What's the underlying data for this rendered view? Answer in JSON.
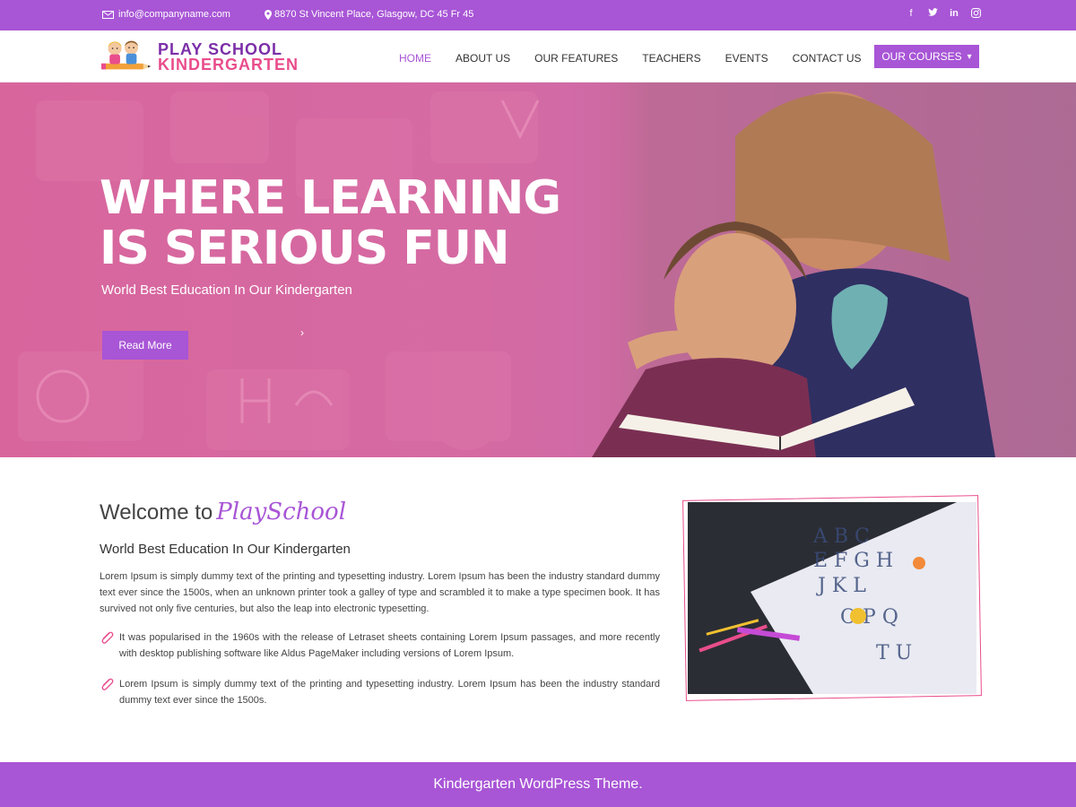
{
  "topbar": {
    "email": "info@companyname.com",
    "address": "8870 St Vincent Place, Glasgow, DC 45 Fr 45",
    "social": [
      {
        "icon": "facebook-icon",
        "glyph": "f"
      },
      {
        "icon": "twitter-icon",
        "glyph": "t"
      },
      {
        "icon": "linkedin-icon",
        "glyph": "in"
      },
      {
        "icon": "instagram-icon",
        "glyph": "◎"
      }
    ]
  },
  "logo": {
    "line1": "PLAY SCHOOL",
    "line2": "KINDERGARTEN"
  },
  "nav": {
    "items": [
      "HOME",
      "ABOUT US",
      "OUR FEATURES",
      "TEACHERS",
      "EVENTS",
      "CONTACT US"
    ],
    "active": "HOME",
    "courses_label": "OUR COURSES",
    "courses_caret": "▾"
  },
  "hero": {
    "title": "WHERE LEARNING IS SERIOUS FUN",
    "subtitle": "World Best Education In Our Kindergarten",
    "button": "Read More",
    "arrow": "›"
  },
  "welcome": {
    "title_prefix": "Welcome to",
    "title_brand": "PlaySchool",
    "subtitle": "World Best Education In Our Kindergarten",
    "paragraph": "Lorem Ipsum is simply dummy text of the printing and typesetting industry. Lorem Ipsum has been the industry standard dummy text ever since the 1500s, when an unknown printer took a galley of type and scrambled it to make a type specimen book. It has survived not only five centuries, but also the leap into electronic typesetting.",
    "bullets": [
      "It was popularised in the 1960s with the release of Letraset sheets containing Lorem Ipsum passages, and more recently with desktop publishing software like Aldus PageMaker including versions of Lorem Ipsum.",
      "Lorem Ipsum is simply dummy text of the printing and typesetting industry. Lorem Ipsum has been the industry standard dummy text ever since the 1500s."
    ]
  },
  "footer": {
    "text": "Kindergarten WordPress Theme."
  },
  "colors": {
    "accent": "#a855d6",
    "pink": "#e94d8c",
    "hero": "#d8669d"
  }
}
